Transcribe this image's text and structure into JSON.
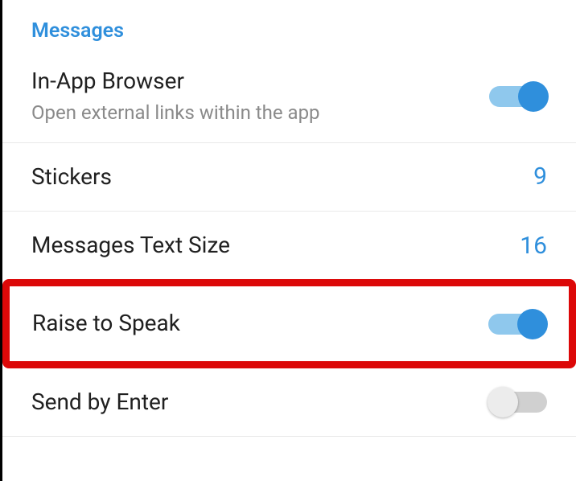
{
  "section": {
    "title": "Messages"
  },
  "rows": {
    "inapp": {
      "title": "In-App Browser",
      "subtitle": "Open external links within the app",
      "toggle_on": true
    },
    "stickers": {
      "title": "Stickers",
      "value": "9"
    },
    "textsize": {
      "title": "Messages Text Size",
      "value": "16"
    },
    "raise": {
      "title": "Raise to Speak",
      "toggle_on": true
    },
    "sendenter": {
      "title": "Send by Enter",
      "toggle_on": false
    }
  }
}
